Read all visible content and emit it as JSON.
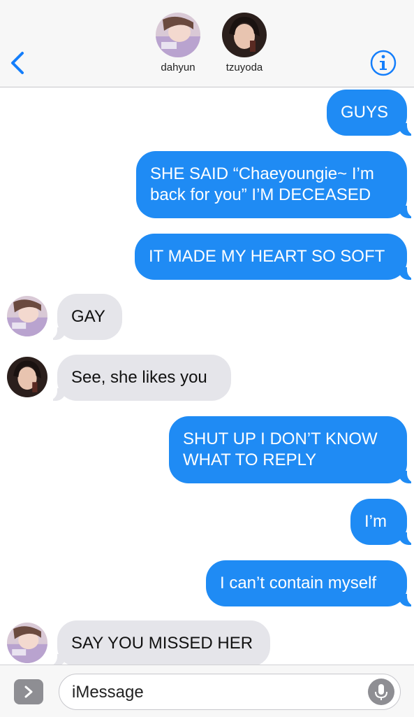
{
  "header": {
    "back_icon": "chevron-left-icon",
    "info_icon": "info-icon",
    "contacts": [
      {
        "name": "dahyun"
      },
      {
        "name": "tzuyoda"
      }
    ]
  },
  "messages": [
    {
      "direction": "sent",
      "text": "GUYS"
    },
    {
      "direction": "sent",
      "lines": [
        "SHE SAID “Chaeyoungie~ I’m",
        "back for you” I’M DECEASED"
      ]
    },
    {
      "direction": "sent",
      "text": "IT MADE MY HEART SO SOFT"
    },
    {
      "direction": "received",
      "sender": "dahyun",
      "text": "GAY"
    },
    {
      "direction": "received",
      "sender": "tzuyoda",
      "text": "See, she likes you"
    },
    {
      "direction": "sent",
      "lines": [
        "SHUT UP I DON’T KNOW",
        "WHAT TO REPLY"
      ]
    },
    {
      "direction": "sent",
      "text": "I’m"
    },
    {
      "direction": "sent",
      "text": "I can’t contain myself"
    },
    {
      "direction": "received",
      "sender": "dahyun",
      "text": "SAY YOU MISSED HER"
    }
  ],
  "input": {
    "placeholder": "iMessage",
    "expand_icon": "chevron-right-icon",
    "mic_icon": "microphone-icon"
  },
  "colors": {
    "sent_bubble": "#1f8bf4",
    "received_bubble": "#e5e5ea",
    "accent": "#147efb"
  }
}
